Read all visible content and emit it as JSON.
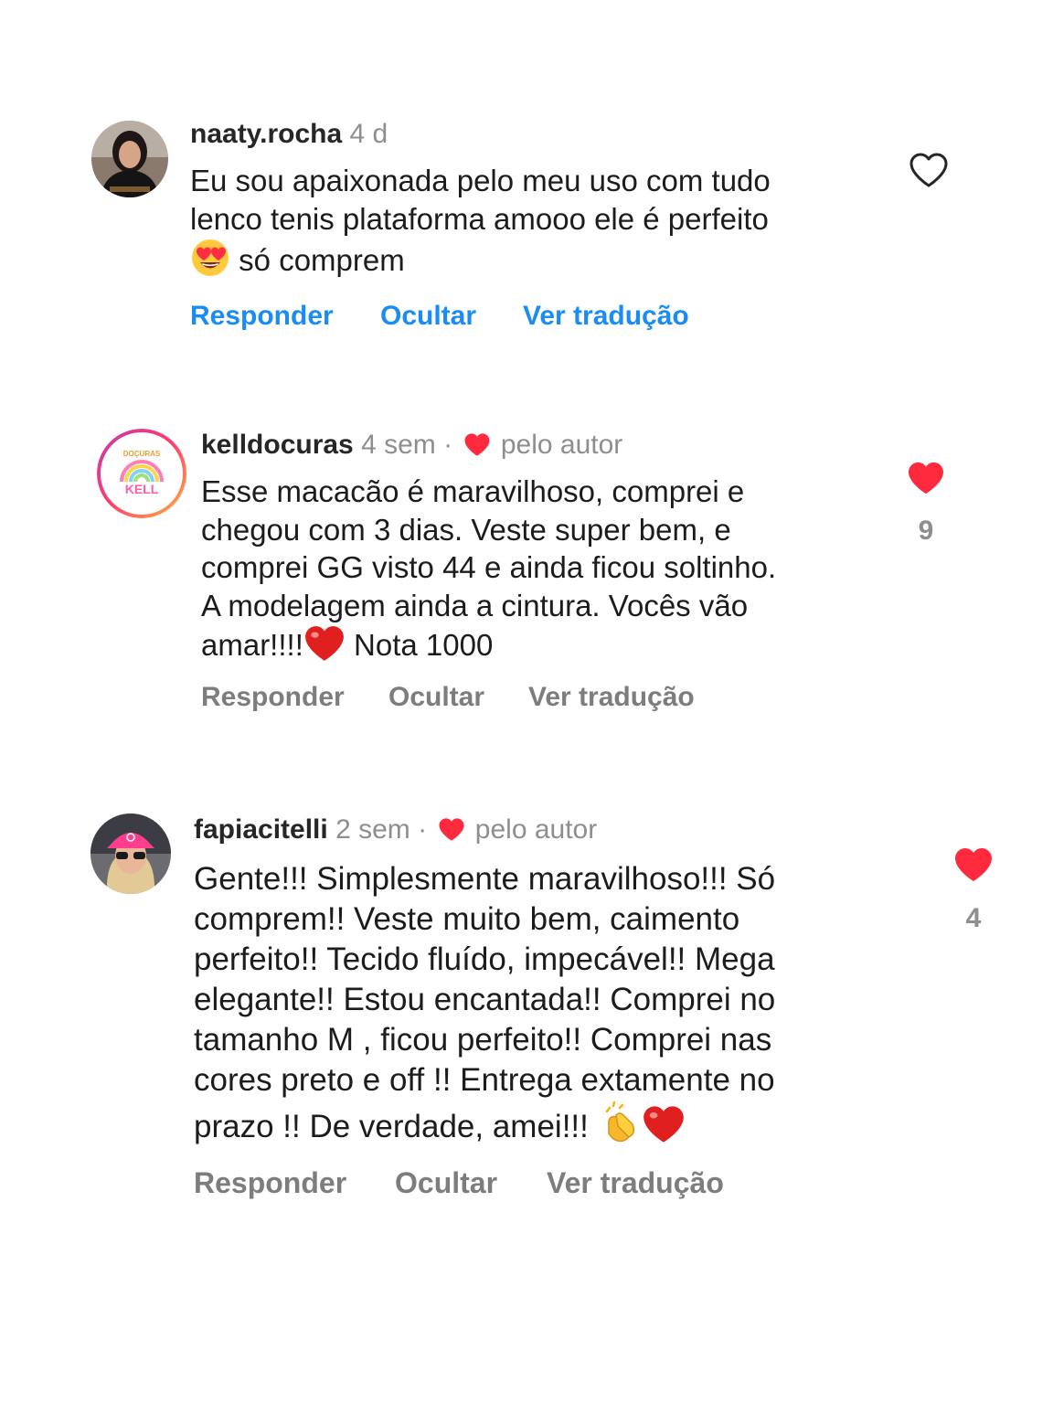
{
  "colors": {
    "link_blue": "#1a8cf6",
    "muted_gray": "#8e8e8e",
    "like_red": "#ff2a3d"
  },
  "comments": [
    {
      "username": "naaty.rocha",
      "time": "4 d",
      "lines": [
        "Eu sou apaixonada pelo meu uso com tudo",
        "lenco tenis plataforma amooo ele é perfeito",
        "só comprem"
      ],
      "leading_emoji": "smiling-face-with-heart-eyes",
      "actions": {
        "reply": "Responder",
        "hide": "Ocultar",
        "translate": "Ver tradução"
      },
      "liked": false,
      "like_icon": "heart-outline-icon"
    },
    {
      "username": "kelldocuras",
      "time": "4 sem",
      "separator": "·",
      "author_badge": "pelo autor",
      "lines": [
        "Esse macacão é maravilhoso,  comprei e",
        "chegou com 3 dias. Veste super bem, e",
        "comprei GG visto 44 e ainda ficou soltinho.",
        "A modelagem ainda a cintura. Vocês  vão",
        "amar!!!!",
        "Nota 1000"
      ],
      "avatar_text": "DOÇURAS",
      "avatar_text2": "KELL",
      "actions": {
        "reply": "Responder",
        "hide": "Ocultar",
        "translate": "Ver tradução"
      },
      "liked": true,
      "like_icon": "heart-filled-icon",
      "like_count": "9"
    },
    {
      "username": "fapiacitelli",
      "time": "2 sem",
      "separator": "·",
      "author_badge": "pelo autor",
      "lines": [
        "Gente!!! Simplesmente maravilhoso!!! Só",
        "comprem!! Veste muito bem, caimento",
        "perfeito!! Tecido fluído,  impecável!! Mega",
        "elegante!! Estou encantada!! Comprei no",
        "tamanho M , ficou perfeito!! Comprei nas",
        "cores preto e off !! Entrega extamente no",
        "prazo !! De verdade, amei!!!"
      ],
      "actions": {
        "reply": "Responder",
        "hide": "Ocultar",
        "translate": "Ver tradução"
      },
      "liked": true,
      "like_icon": "heart-filled-icon",
      "like_count": "4"
    }
  ]
}
